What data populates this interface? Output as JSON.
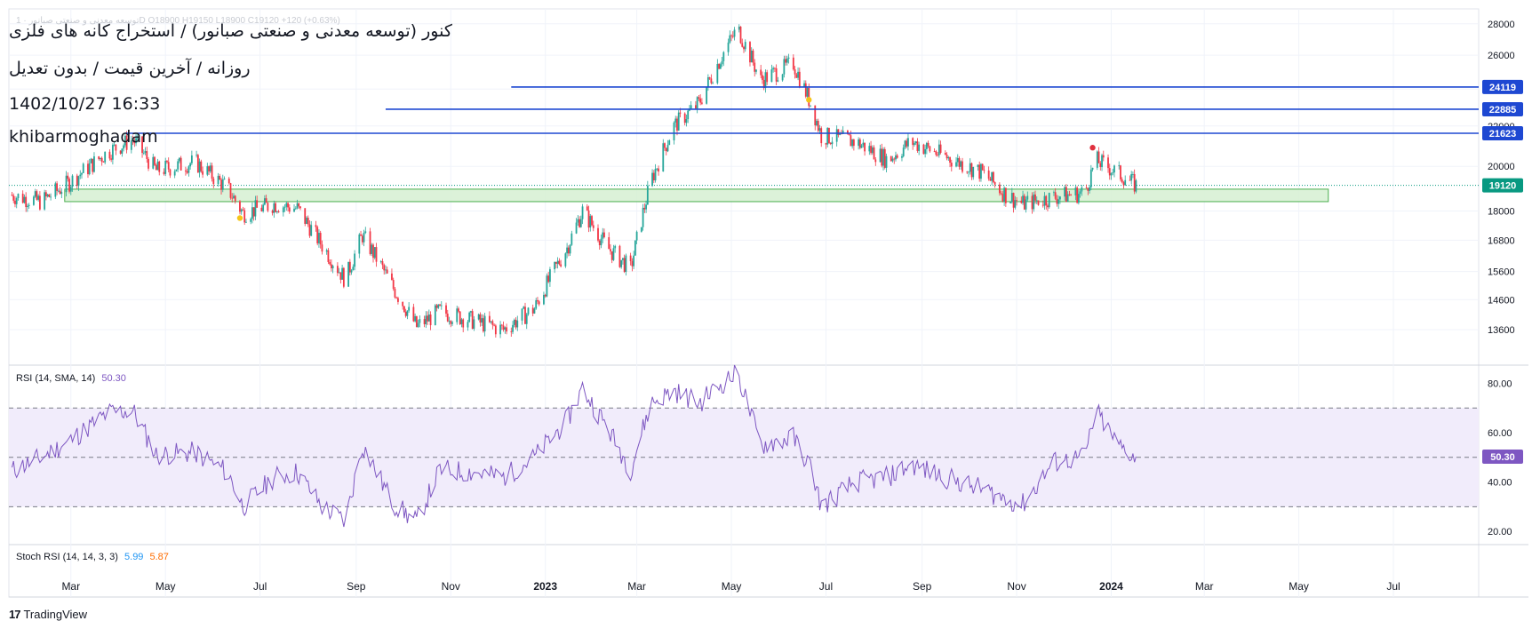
{
  "header": {
    "symbol_line": "توسعه معدنی و صنعتی صبانور · 1D  O18900  H19150  L18900  C19120  +120 (+0.63%)",
    "title": "کنور (توسعه معدنی و صنعتی صبانور) / استخراج کانه های فلزی",
    "subtitle": "روزانه / آخرین قیمت / بدون تعدیل",
    "datetime": "1402/10/27 16:33",
    "author": "khibarmoghadam"
  },
  "footer": {
    "logo_text": "TradingView",
    "logo_mark": "17"
  },
  "colors": {
    "up": "#26a69a",
    "down": "#f23645",
    "hline": "#1e48d2",
    "zone_fill": "#d6f0d2",
    "zone_border": "#4caf50",
    "rsi_line": "#7e57c2",
    "rsi_band": "#f1ecfb",
    "price_tag": "#089981"
  },
  "chart_data": [
    {
      "type": "candlestick",
      "title": "",
      "y_axis_side": "right",
      "yticks": [
        13600,
        14600,
        15600,
        16800,
        18000,
        20000,
        22000,
        24000,
        26000,
        28000
      ],
      "ylim": [
        12800,
        28400
      ],
      "xticks": [
        "Mar",
        "May",
        "Jul",
        "Sep",
        "Nov",
        "2023",
        "Mar",
        "May",
        "Jul",
        "Sep",
        "Nov",
        "2024",
        "Mar",
        "May",
        "Jul"
      ],
      "x_range": [
        "2022-01-20",
        "2024-08-25"
      ],
      "last_price": 19120,
      "horizontal_lines": [
        {
          "value": 24119,
          "label": "24119",
          "start": "2022-12-10"
        },
        {
          "value": 22885,
          "label": "22885",
          "start": "2022-09-20"
        },
        {
          "value": 21623,
          "label": "21623",
          "start": "2022-04-05"
        }
      ],
      "support_zone": {
        "low": 18400,
        "high": 18950,
        "start": "2022-02-25",
        "end": "2024-05-20"
      },
      "markers": [
        {
          "date": "2022-06-18",
          "value": 17700,
          "color": "#f5c518"
        },
        {
          "date": "2023-06-20",
          "value": 23400,
          "color": "#f5c518"
        },
        {
          "date": "2023-12-20",
          "value": 20900,
          "color": "#e0303d"
        }
      ],
      "price_path": [
        [
          "2022-01-20",
          18700
        ],
        [
          "2022-02-10",
          18400
        ],
        [
          "2022-03-01",
          19300
        ],
        [
          "2022-03-25",
          20700
        ],
        [
          "2022-04-10",
          21300
        ],
        [
          "2022-04-25",
          19800
        ],
        [
          "2022-05-20",
          20200
        ],
        [
          "2022-06-10",
          19000
        ],
        [
          "2022-06-20",
          17900
        ],
        [
          "2022-07-10",
          18300
        ],
        [
          "2022-07-25",
          18100
        ],
        [
          "2022-08-10",
          16600
        ],
        [
          "2022-08-25",
          15300
        ],
        [
          "2022-09-05",
          17000
        ],
        [
          "2022-09-25",
          15000
        ],
        [
          "2022-10-10",
          13700
        ],
        [
          "2022-10-25",
          14200
        ],
        [
          "2022-11-15",
          13900
        ],
        [
          "2022-12-05",
          13600
        ],
        [
          "2022-12-25",
          14300
        ],
        [
          "2023-01-15",
          16500
        ],
        [
          "2023-01-25",
          18000
        ],
        [
          "2023-02-10",
          16500
        ],
        [
          "2023-02-25",
          15700
        ],
        [
          "2023-03-10",
          19300
        ],
        [
          "2023-03-25",
          22000
        ],
        [
          "2023-04-10",
          23200
        ],
        [
          "2023-04-25",
          26000
        ],
        [
          "2023-05-05",
          27700
        ],
        [
          "2023-05-20",
          24500
        ],
        [
          "2023-06-10",
          25500
        ],
        [
          "2023-06-22",
          23000
        ],
        [
          "2023-06-28",
          21500
        ],
        [
          "2023-07-20",
          21200
        ],
        [
          "2023-08-10",
          20300
        ],
        [
          "2023-08-25",
          21200
        ],
        [
          "2023-09-15",
          20500
        ],
        [
          "2023-10-10",
          19700
        ],
        [
          "2023-10-25",
          18700
        ],
        [
          "2023-11-05",
          18300
        ],
        [
          "2023-11-25",
          18600
        ],
        [
          "2023-12-15",
          18800
        ],
        [
          "2023-12-22",
          20300
        ],
        [
          "2024-01-05",
          19700
        ],
        [
          "2024-01-17",
          19120
        ]
      ]
    },
    {
      "type": "line",
      "title": "RSI (14, SMA, 14)",
      "label_name": "RSI (14, SMA, 14)",
      "last_value": "50.30",
      "yticks": [
        "80.00",
        "60.00",
        "40.00",
        "20.00"
      ],
      "ylim": [
        15,
        87
      ],
      "band": [
        30,
        70
      ],
      "midline": 50,
      "series": [
        {
          "name": "RSI",
          "points": [
            [
              "2022-01-20",
              44
            ],
            [
              "2022-02-10",
              50
            ],
            [
              "2022-03-01",
              57
            ],
            [
              "2022-03-25",
              68
            ],
            [
              "2022-04-10",
              69
            ],
            [
              "2022-04-25",
              51
            ],
            [
              "2022-05-20",
              52
            ],
            [
              "2022-06-10",
              44
            ],
            [
              "2022-06-20",
              30
            ],
            [
              "2022-07-10",
              42
            ],
            [
              "2022-07-25",
              44
            ],
            [
              "2022-08-10",
              30
            ],
            [
              "2022-08-25",
              24
            ],
            [
              "2022-09-05",
              55
            ],
            [
              "2022-09-25",
              31
            ],
            [
              "2022-10-10",
              24
            ],
            [
              "2022-10-25",
              45
            ],
            [
              "2022-11-15",
              44
            ],
            [
              "2022-12-05",
              42
            ],
            [
              "2022-12-25",
              50
            ],
            [
              "2023-01-15",
              65
            ],
            [
              "2023-01-25",
              78
            ],
            [
              "2023-02-10",
              62
            ],
            [
              "2023-02-25",
              45
            ],
            [
              "2023-03-10",
              72
            ],
            [
              "2023-03-25",
              77
            ],
            [
              "2023-04-10",
              72
            ],
            [
              "2023-04-25",
              80
            ],
            [
              "2023-05-05",
              84
            ],
            [
              "2023-05-20",
              55
            ],
            [
              "2023-06-10",
              58
            ],
            [
              "2023-06-22",
              45
            ],
            [
              "2023-06-28",
              30
            ],
            [
              "2023-07-20",
              40
            ],
            [
              "2023-08-10",
              42
            ],
            [
              "2023-08-25",
              47
            ],
            [
              "2023-09-15",
              42
            ],
            [
              "2023-10-10",
              37
            ],
            [
              "2023-10-25",
              33
            ],
            [
              "2023-11-05",
              31
            ],
            [
              "2023-11-25",
              48
            ],
            [
              "2023-12-15",
              50
            ],
            [
              "2023-12-22",
              69
            ],
            [
              "2024-01-05",
              55
            ],
            [
              "2024-01-17",
              50.3
            ]
          ]
        }
      ]
    },
    {
      "type": "line",
      "title": "Stoch RSI (14, 14, 3, 3)",
      "label_name": "Stoch RSI (14, 14, 3, 3)",
      "series": [
        {
          "name": "K",
          "last_value": "5.99",
          "color": "#2196f3"
        },
        {
          "name": "D",
          "last_value": "5.87",
          "color": "#ff6d00"
        }
      ]
    }
  ]
}
